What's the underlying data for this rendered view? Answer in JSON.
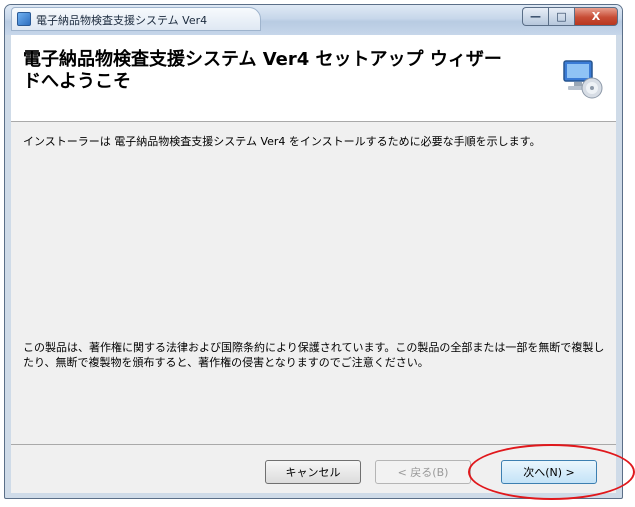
{
  "window": {
    "title": "電子納品物検査支援システム Ver4",
    "buttons": {
      "minimize": "—",
      "maximize": "□",
      "close": "X"
    }
  },
  "header": {
    "title": "電子納品物検査支援システム Ver4 セットアップ ウィザードへようこそ",
    "icon": "setup-computer-cd-icon"
  },
  "body": {
    "intro": "インストーラーは 電子納品物検査支援システム Ver4 をインストールするために必要な手順を示します。",
    "copyright": "この製品は、著作権に関する法律および国際条約により保護されています。この製品の全部または一部を無断で複製したり、無断で複製物を頒布すると、著作権の侵害となりますのでご注意ください。"
  },
  "footer": {
    "cancel": "キャンセル",
    "back": "< 戻る(B)",
    "next": "次へ(N) >"
  },
  "annotation": {
    "color": "#e0181c"
  }
}
